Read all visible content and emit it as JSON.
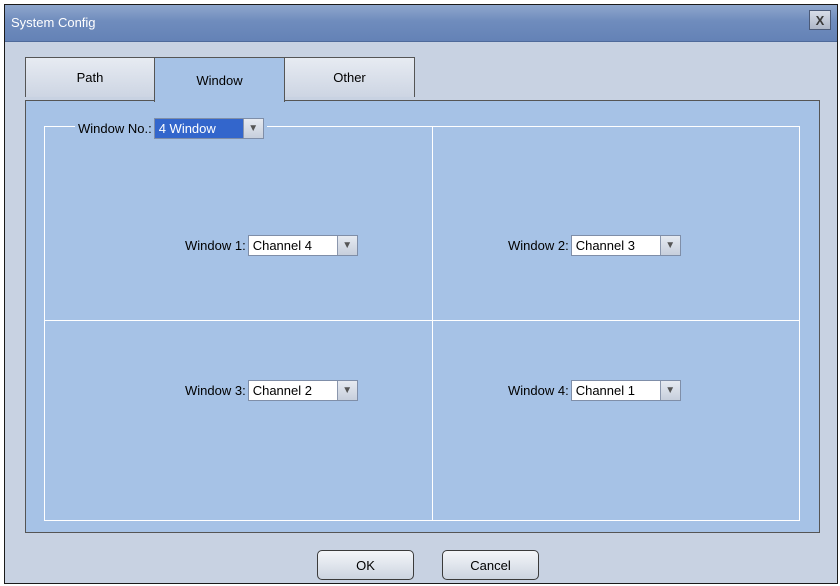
{
  "window": {
    "title": "System Config",
    "close_label": "X"
  },
  "tabs": [
    {
      "label": "Path",
      "active": false
    },
    {
      "label": "Window",
      "active": true
    },
    {
      "label": "Other",
      "active": false
    }
  ],
  "window_no": {
    "label": "Window No.:",
    "value": "4 Window"
  },
  "channels": [
    {
      "label": "Window 1:",
      "value": "Channel 4"
    },
    {
      "label": "Window 2:",
      "value": "Channel 3"
    },
    {
      "label": "Window 3:",
      "value": "Channel 2"
    },
    {
      "label": "Window 4:",
      "value": "Channel 1"
    }
  ],
  "buttons": {
    "ok": "OK",
    "cancel": "Cancel"
  },
  "icons": {
    "close": "close-icon",
    "dropdown": "chevron-down-icon"
  },
  "colors": {
    "panel": "#a6c2e6",
    "titlebar": "#6f8cbd",
    "selection": "#3366cc"
  }
}
